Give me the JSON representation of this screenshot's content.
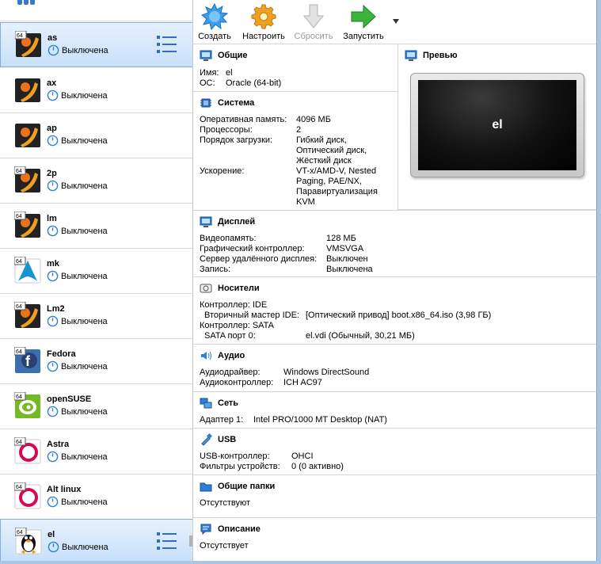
{
  "toolbar": {
    "create": "Создать",
    "settings": "Настроить",
    "reset": "Сбросить",
    "start": "Запустить"
  },
  "vms": [
    {
      "name": "as",
      "status": "Выключена",
      "os": "arch",
      "badge": "64",
      "selected": true
    },
    {
      "name": "ax",
      "status": "Выключена",
      "os": "arch",
      "badge": "",
      "selected": false
    },
    {
      "name": "ap",
      "status": "Выключена",
      "os": "arch",
      "badge": "",
      "selected": false
    },
    {
      "name": "2p",
      "status": "Выключена",
      "os": "arch",
      "badge": "64",
      "selected": false
    },
    {
      "name": "lm",
      "status": "Выключена",
      "os": "arch",
      "badge": "64",
      "selected": false
    },
    {
      "name": "mk",
      "status": "Выключена",
      "os": "archlinux",
      "badge": "64",
      "selected": false
    },
    {
      "name": "Lm2",
      "status": "Выключена",
      "os": "arch",
      "badge": "64",
      "selected": false
    },
    {
      "name": "Fedora",
      "status": "Выключена",
      "os": "fedora",
      "badge": "64",
      "selected": false
    },
    {
      "name": "openSUSE",
      "status": "Выключена",
      "os": "opensuse",
      "badge": "64",
      "selected": false
    },
    {
      "name": "Astra",
      "status": "Выключена",
      "os": "debian",
      "badge": "64",
      "selected": false
    },
    {
      "name": "Alt linux",
      "status": "Выключена",
      "os": "debian",
      "badge": "64",
      "selected": false
    },
    {
      "name": "el",
      "status": "Выключена",
      "os": "linux",
      "badge": "64",
      "selected": true
    }
  ],
  "general": {
    "title": "Общие",
    "name_label": "Имя:",
    "name_value": "el",
    "os_label": "ОС:",
    "os_value": "Oracle (64-bit)"
  },
  "preview": {
    "title": "Превью",
    "screen_text": "el"
  },
  "system": {
    "title": "Система",
    "ram_label": "Оперативная память:",
    "ram_value": "4096 МБ",
    "cpu_label": "Процессоры:",
    "cpu_value": "2",
    "boot_label": "Порядок загрузки:",
    "boot_1": "Гибкий диск,",
    "boot_2": "Оптический диск,",
    "boot_3": "Жёсткий диск",
    "accel_label": "Ускорение:",
    "accel_1": "VT-x/AMD-V, Nested",
    "accel_2": "Paging, PAE/NX,",
    "accel_3": "Паравиртуализация",
    "accel_4": "KVM"
  },
  "display": {
    "title": "Дисплей",
    "vram_label": "Видеопамять:",
    "vram_value": "128 МБ",
    "gfx_label": "Графический контроллер:",
    "gfx_value": "VMSVGA",
    "rdp_label": "Сервер удалённого дисплея:",
    "rdp_value": "Выключен",
    "rec_label": "Запись:",
    "rec_value": "Выключена"
  },
  "storage": {
    "title": "Носители",
    "ctrl1": "Контроллер: IDE",
    "ide_label": "Вторичный мастер IDE:",
    "ide_value": "[Оптический привод] boot.x86_64.iso (3,98 ГБ)",
    "ctrl2": "Контроллер: SATA",
    "sata_label": "SATA порт 0:",
    "sata_value": "el.vdi (Обычный, 30,21 МБ)"
  },
  "audio": {
    "title": "Аудио",
    "driver_label": "Аудиодрайвер:",
    "driver_value": "Windows DirectSound",
    "ctrl_label": "Аудиоконтроллер:",
    "ctrl_value": "ICH AC97"
  },
  "network": {
    "title": "Сеть",
    "adapter_label": "Адаптер 1:",
    "adapter_value": "Intel PRO/1000 MT Desktop (NAT)"
  },
  "usb": {
    "title": "USB",
    "ctrl_label": "USB-контроллер:",
    "ctrl_value": "OHCI",
    "filters_label": "Фильтры устройств:",
    "filters_value": "0 (0 активно)"
  },
  "shared": {
    "title": "Общие папки",
    "value": "Отсутствуют"
  },
  "description": {
    "title": "Описание",
    "value": "Отсутствует"
  },
  "colors": {
    "selection_border": "#84acdd",
    "accent_blue": "#2f7fd6",
    "arrow_green": "#3cb43c",
    "gear_orange": "#f0a020"
  }
}
